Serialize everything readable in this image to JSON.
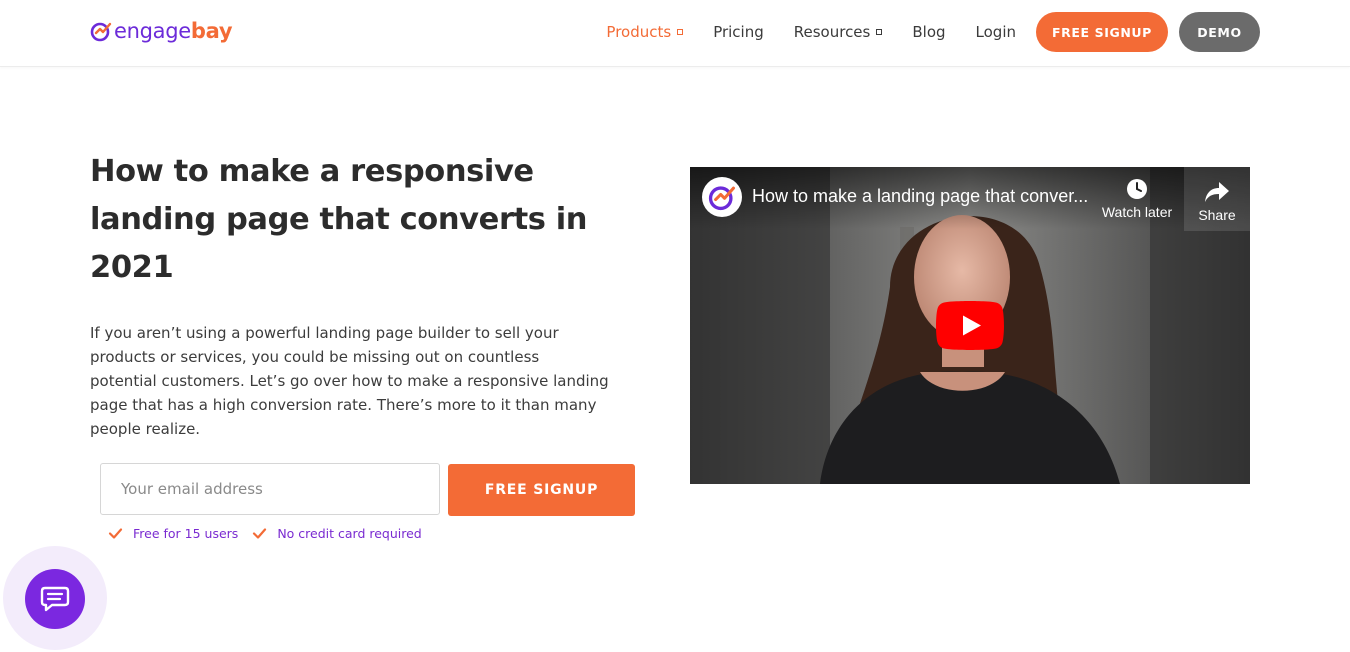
{
  "brand": {
    "logo_part1": "engage",
    "logo_part2": "bay",
    "primary_color": "#f36b36",
    "accent_color": "#7b28e0"
  },
  "nav": {
    "items": [
      {
        "label": "Products",
        "has_caret": true,
        "active": true
      },
      {
        "label": "Pricing",
        "has_caret": false,
        "active": false
      },
      {
        "label": "Resources",
        "has_caret": true,
        "active": false
      },
      {
        "label": "Blog",
        "has_caret": false,
        "active": false
      },
      {
        "label": "Login",
        "has_caret": false,
        "active": false
      }
    ],
    "signup_label": "FREE SIGNUP",
    "demo_label": "DEMO"
  },
  "hero": {
    "title": "How to make a responsive landing page that converts in 2021",
    "description": "If you aren’t using a powerful landing page builder to sell your products or services, you could be missing out on countless potential customers. Let’s go over how to make a responsive landing page that has a high conversion rate. There’s more to it than many people realize.",
    "email_placeholder": "Your email address",
    "signup_label": "FREE SIGNUP",
    "perks": [
      "Free for 15 users",
      "No credit card required"
    ]
  },
  "video": {
    "title": "How to make a landing page that conver...",
    "watch_later_label": "Watch later",
    "share_label": "Share",
    "icons": [
      "clock-icon",
      "share-arrow-icon",
      "youtube-play-icon"
    ]
  },
  "chat": {
    "icon": "chat-bubble-icon"
  }
}
